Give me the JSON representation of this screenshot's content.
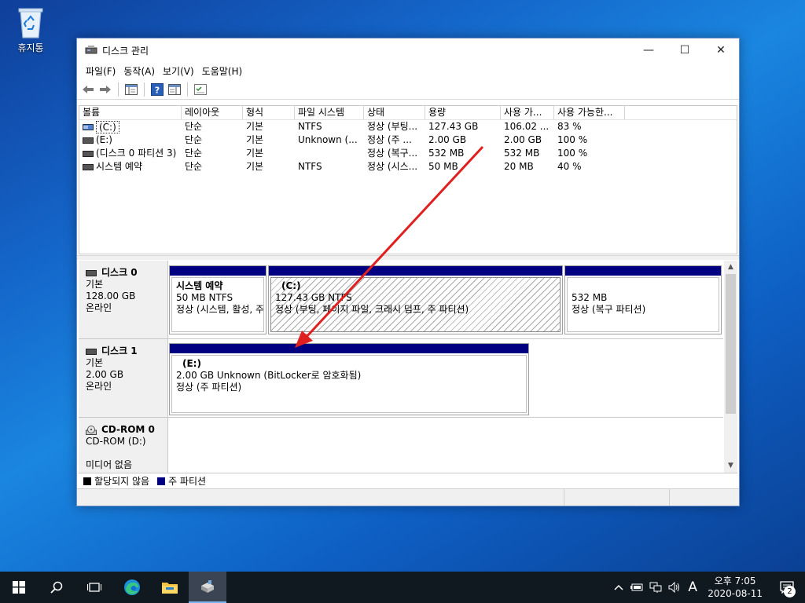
{
  "desktop": {
    "recycle_bin_label": "휴지통"
  },
  "window": {
    "title": "디스크 관리",
    "minimize": "—",
    "maximize": "☐",
    "close": "✕"
  },
  "menu": [
    "파일(F)",
    "동작(A)",
    "보기(V)",
    "도움말(H)"
  ],
  "volume_table": {
    "headers": [
      "볼륨",
      "레이아웃",
      "형식",
      "파일 시스템",
      "상태",
      "용량",
      "사용 가...",
      "사용 가능한..."
    ],
    "rows": [
      [
        "(C:)",
        "단순",
        "기본",
        "NTFS",
        "정상 (부팅...",
        "127.43 GB",
        "106.02 ...",
        "83 %"
      ],
      [
        "(E:)",
        "단순",
        "기본",
        "Unknown (...",
        "정상 (주 ...",
        "2.00 GB",
        "2.00 GB",
        "100 %"
      ],
      [
        "(디스크 0 파티션 3)",
        "단순",
        "기본",
        "",
        "정상 (복구...",
        "532 MB",
        "532 MB",
        "100 %"
      ],
      [
        "시스템 예약",
        "단순",
        "기본",
        "NTFS",
        "정상 (시스...",
        "50 MB",
        "20 MB",
        "40 %"
      ]
    ]
  },
  "disks": {
    "disk0": {
      "name": "디스크 0",
      "type": "기본",
      "size": "128.00 GB",
      "status": "온라인",
      "partitions": {
        "sysres": {
          "title": "시스템 예약",
          "size": "50 MB NTFS",
          "status": "정상 (시스템, 활성, 주"
        },
        "c": {
          "title": "(C:)",
          "size": "127.43 GB NTFS",
          "status": "정상 (부팅, 페이지 파일, 크래시 덤프, 주 파티션)"
        },
        "recovery": {
          "title": "",
          "size": "532 MB",
          "status": "정상 (복구 파티션)"
        }
      }
    },
    "disk1": {
      "name": "디스크 1",
      "type": "기본",
      "size": "2.00 GB",
      "status": "온라인",
      "partitions": {
        "e": {
          "title": "(E:)",
          "size": "2.00 GB Unknown (BitLocker로 암호화됨)",
          "status": "정상 (주 파티션)"
        }
      }
    },
    "cdrom0": {
      "name": "CD-ROM 0",
      "type": "CD-ROM (D:)",
      "status": "미디어 없음"
    }
  },
  "legend": {
    "unallocated": "할당되지 않음",
    "primary": "주 파티션"
  },
  "colors": {
    "primary_partition": "#000080",
    "unallocated": "#000000",
    "annotation_arrow": "#e02020"
  },
  "taskbar": {
    "ime": "A",
    "time": "오후 7:05",
    "date": "2020-08-11",
    "notification_count": "2"
  }
}
